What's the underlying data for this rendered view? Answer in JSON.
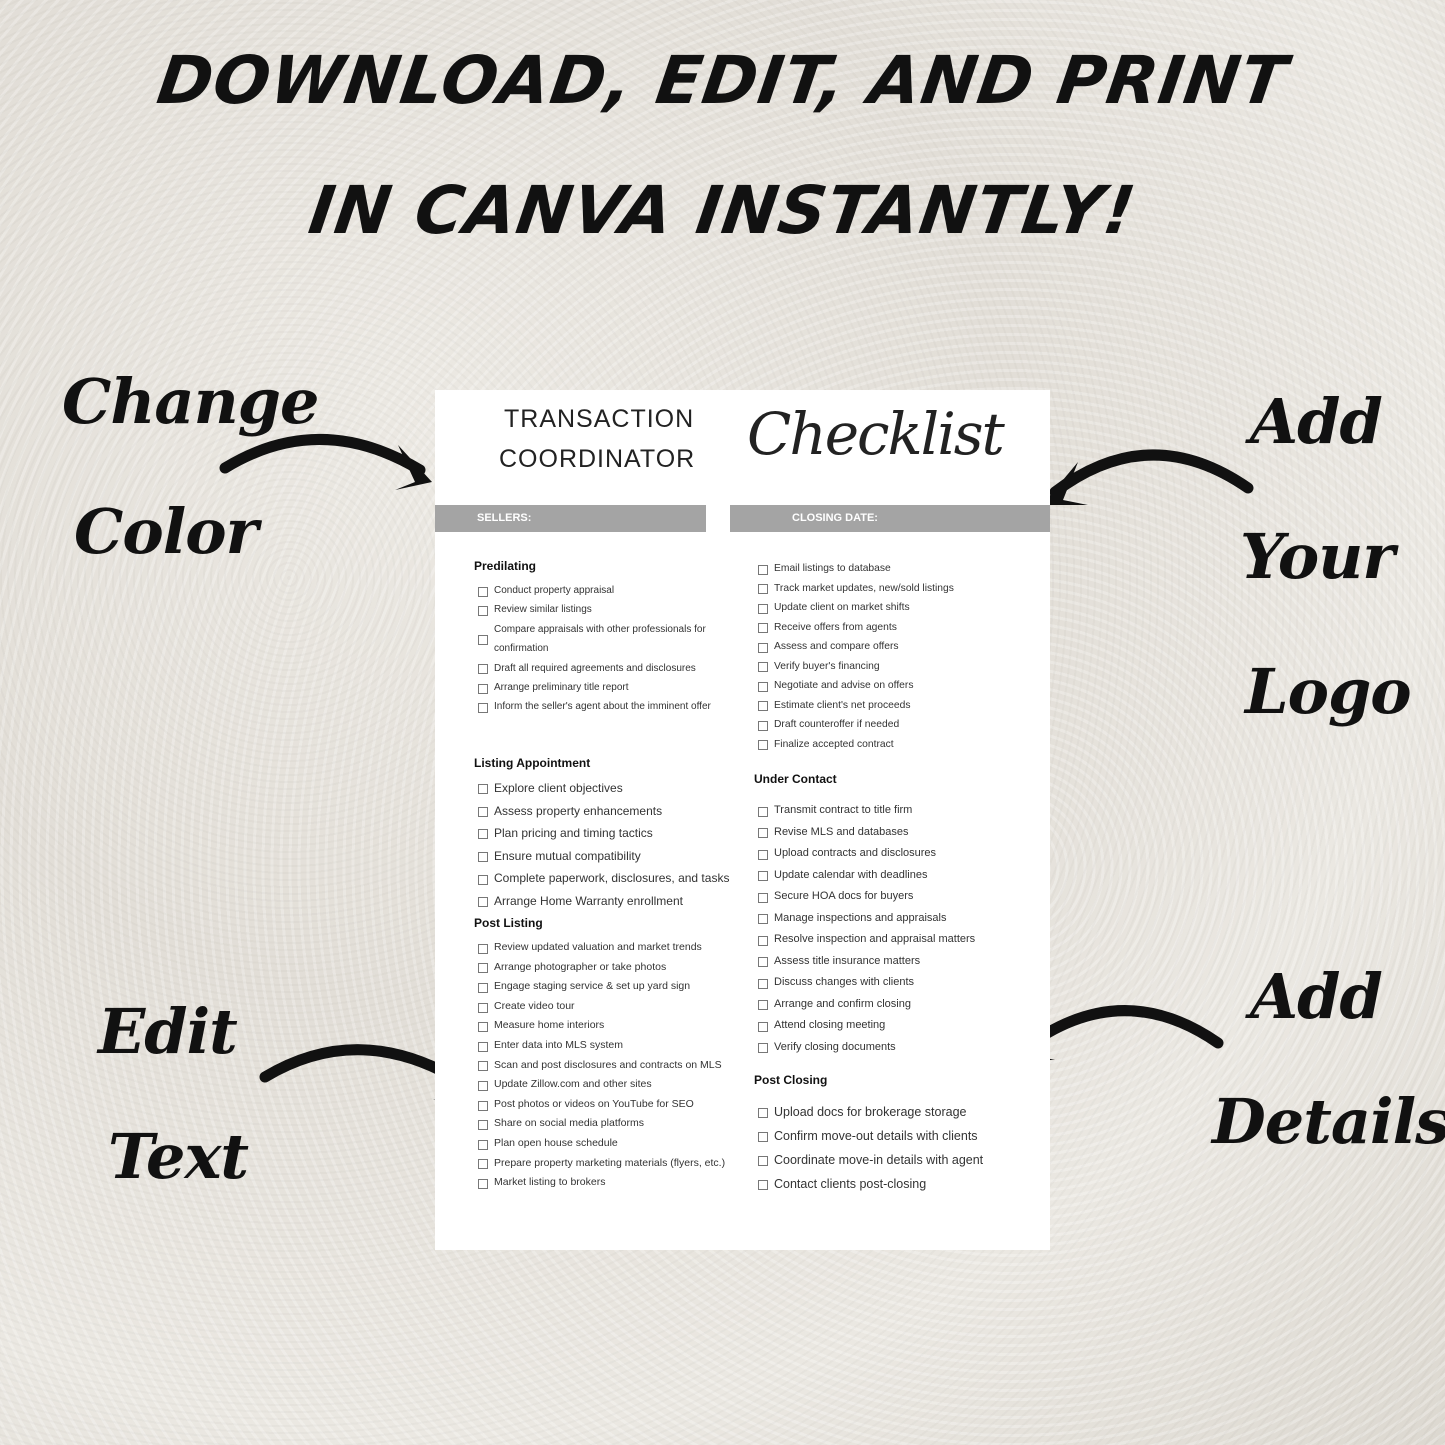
{
  "headline": {
    "line1": "DOWNLOAD, EDIT, AND PRINT",
    "line2": "IN CANVA INSTANTLY!"
  },
  "annotations": {
    "change_color": [
      "Change",
      "Color"
    ],
    "add_logo": [
      "Add",
      "Your",
      "Logo"
    ],
    "edit_text": [
      "Edit",
      "Text"
    ],
    "add_details": [
      "Add",
      "Details"
    ]
  },
  "document": {
    "title_line1": "TRANSACTION",
    "title_line2": "COORDINATOR",
    "title_script": "Checklist",
    "sellers_label": "SELLERS:",
    "closing_label": "CLOSING DATE:",
    "bar_color": "#a4a4a4",
    "left": [
      {
        "heading": "Predilating",
        "items": [
          "Conduct property appraisal",
          "Review similar listings",
          "Compare appraisals with other professionals for confirmation",
          "Draft all required agreements and disclosures",
          "Arrange preliminary title report",
          "Inform the seller's agent about the imminent offer"
        ]
      },
      {
        "heading": "Listing Appointment",
        "items": [
          "Explore client objectives",
          "Assess property enhancements",
          "Plan pricing and timing tactics",
          "Ensure mutual compatibility",
          "Complete paperwork, disclosures, and tasks",
          "Arrange Home Warranty enrollment"
        ]
      },
      {
        "heading": "Post Listing",
        "items": [
          "Review updated valuation and market trends",
          "Arrange photographer or take photos",
          "Engage staging service & set up yard sign",
          "Create video tour",
          "Measure home interiors",
          "Enter data into MLS system",
          "Scan and post disclosures and contracts on MLS",
          "Update Zillow.com and other sites",
          "Post photos or videos on YouTube for SEO",
          "Share on social media platforms",
          "Plan open house schedule",
          "Prepare property marketing materials (flyers, etc.)",
          "Market listing to brokers"
        ]
      }
    ],
    "right": [
      {
        "heading": "",
        "items": [
          "Email listings to database",
          "Track market updates, new/sold listings",
          "Update client on market shifts",
          "Receive offers from agents",
          "Assess and compare offers",
          "Verify buyer's financing",
          "Negotiate and advise on offers",
          "Estimate client's net proceeds",
          "Draft counteroffer if needed",
          "Finalize accepted contract"
        ]
      },
      {
        "heading": "Under Contact",
        "items": [
          "Transmit contract to title firm",
          "Revise MLS and databases",
          "Upload contracts and disclosures",
          "Update calendar with deadlines",
          "Secure HOA docs for buyers",
          "Manage inspections and appraisals",
          "Resolve inspection and appraisal matters",
          "Assess title insurance matters",
          "Discuss changes with clients",
          "Arrange and confirm closing",
          "Attend closing meeting",
          "Verify closing documents"
        ]
      },
      {
        "heading": "Post Closing",
        "items": [
          "Upload docs for brokerage storage",
          "Confirm move-out details with clients",
          "Coordinate move-in details with agent",
          "Contact clients post-closing"
        ]
      }
    ]
  }
}
